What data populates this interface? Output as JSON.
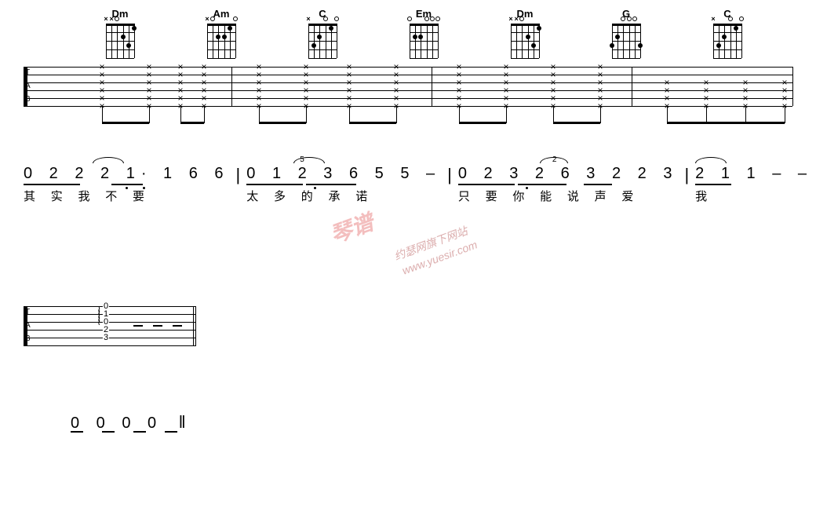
{
  "chords": [
    {
      "name": "Dm"
    },
    {
      "name": "Am"
    },
    {
      "name": "C"
    },
    {
      "name": "Em"
    },
    {
      "name": "Dm"
    },
    {
      "name": "G"
    },
    {
      "name": "C"
    }
  ],
  "tab_labels": {
    "t": "T",
    "a": "A",
    "b": "B"
  },
  "jianpu": {
    "bars": [
      {
        "nums": "0 2 2 2 1·  1 6 6",
        "lyr": "其 实 我 不    要"
      },
      {
        "nums": "0 1 2 3 6 5 5  –",
        "lyr": "太 多 的 承     诺",
        "sup": "5"
      },
      {
        "nums": "0 2 3 2 6 3 2   2 3",
        "lyr": "只 要 你 能 说 声  爱",
        "sup": "2"
      },
      {
        "nums": "2 1 1   –   –",
        "lyr": "我"
      }
    ],
    "coda": "0  0  0  0"
  },
  "staff2": {
    "frets": [
      "0",
      "1",
      "0",
      "2",
      "3"
    ]
  },
  "watermark": {
    "big": "琴谱",
    "small1": "约瑟网旗下网站",
    "small2": "www.yuesir.com"
  }
}
